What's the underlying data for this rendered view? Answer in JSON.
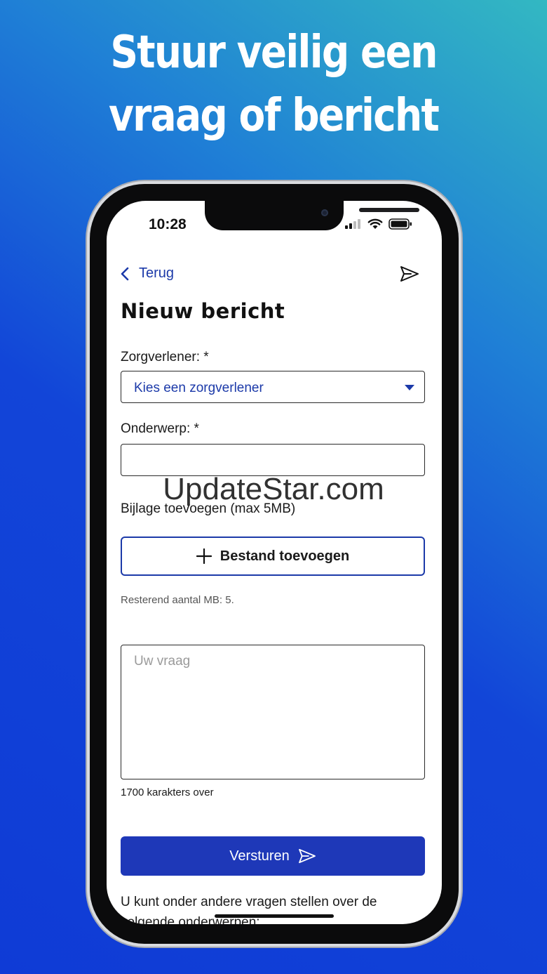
{
  "headline": {
    "line1": "Stuur veilig een",
    "line2": "vraag of bericht"
  },
  "status_bar": {
    "time": "10:28"
  },
  "nav": {
    "back_label": "Terug"
  },
  "form": {
    "title": "Nieuw bericht",
    "provider_label": "Zorgverlener: *",
    "provider_value": "Kies een zorgverlener",
    "subject_label": "Onderwerp: *",
    "subject_value": "",
    "attachment_label": "Bijlage toevoegen (max 5MB)",
    "add_file_label": "Bestand toevoegen",
    "remaining_mb": "Resterend aantal MB: 5.",
    "question_placeholder": "Uw vraag",
    "chars_remaining": "1700 karakters over",
    "submit_label": "Versturen",
    "footer_text": "U kunt onder andere vragen stellen over de volgende onderwerpen:"
  },
  "watermark": "UpdateStar.com",
  "colors": {
    "accent": "#1c3aa9",
    "button": "#1e38b8"
  }
}
